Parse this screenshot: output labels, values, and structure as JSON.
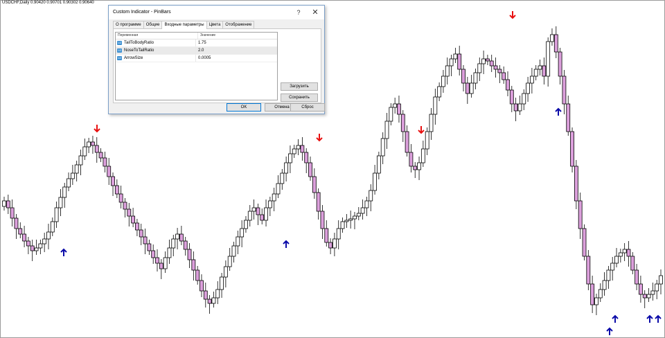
{
  "chart": {
    "symbol_label": "USDCHF,Daily  0.90420 0.90701 0.90302 0.90640",
    "colors": {
      "bull": "#ffffff",
      "bear": "#dca0dc",
      "outline": "#000000",
      "arrow_down": "#e81010",
      "arrow_up": "#0a0aa8"
    }
  },
  "dialog": {
    "title": "Custom Indicator - PinBars",
    "help_label": "?",
    "close_label": "✕",
    "tabs": [
      "О программе",
      "Общие",
      "Входные параметры",
      "Цвета",
      "Отображение"
    ],
    "active_tab": 2,
    "grid": {
      "col_variable": "Переменная",
      "col_value": "Значение",
      "rows": [
        {
          "type_icon": "1/2",
          "name": "TailToBodyRatio",
          "value": "1.75"
        },
        {
          "type_icon": "1/2",
          "name": "NoseToTailRatio",
          "value": "2.0"
        },
        {
          "type_icon": "1/2",
          "name": "ArrowSize",
          "value": "0.0005"
        }
      ]
    },
    "load_label": "Загрузить",
    "save_label": "Сохранить",
    "ok_label": "OK",
    "cancel_label": "Отмена",
    "reset_label": "Сброс"
  }
}
